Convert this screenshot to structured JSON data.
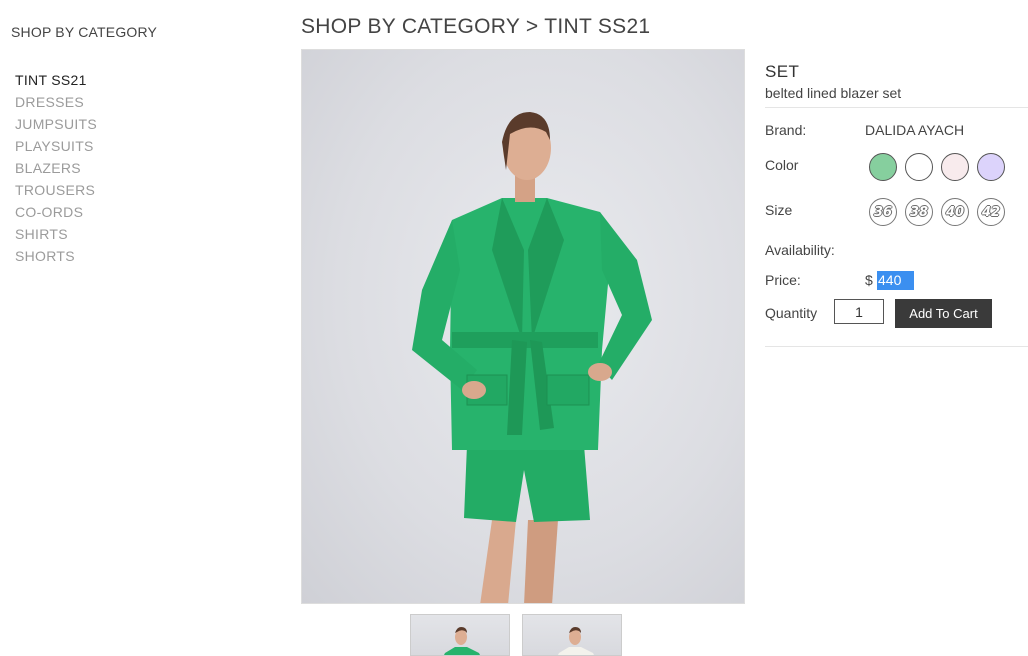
{
  "sidebar": {
    "title": "SHOP BY CATEGORY",
    "categories": [
      {
        "label": "TINT SS21"
      },
      {
        "label": "DRESSES"
      },
      {
        "label": "JUMPSUITS"
      },
      {
        "label": "PLAYSUITS"
      },
      {
        "label": "BLAZERS"
      },
      {
        "label": "TROUSERS"
      },
      {
        "label": "CO-ORDS"
      },
      {
        "label": "SHIRTS"
      },
      {
        "label": "SHORTS"
      }
    ],
    "active_index": 0
  },
  "breadcrumb": "SHOP BY CATEGORY > TINT SS21",
  "product": {
    "title": "SET",
    "subtitle": "belted lined blazer set",
    "brand_label": "Brand:",
    "brand_value": "DALIDA AYACH",
    "color_label": "Color",
    "colors": [
      "#86cf9e",
      "#ffffff",
      "#f8ebed",
      "#dcd3fb"
    ],
    "size_label": "Size",
    "sizes": [
      "36",
      "38",
      "40",
      "42"
    ],
    "availability_label": "Availability:",
    "price_label": "Price:",
    "currency": "$",
    "price": "440",
    "quantity_label": "Quantity",
    "quantity": "1",
    "add_to_cart": "Add To Cart"
  },
  "colors": {
    "blazer_green": "#27b36c",
    "button_bg": "#3a3a3a",
    "selection_blue": "#3b8ff0"
  }
}
